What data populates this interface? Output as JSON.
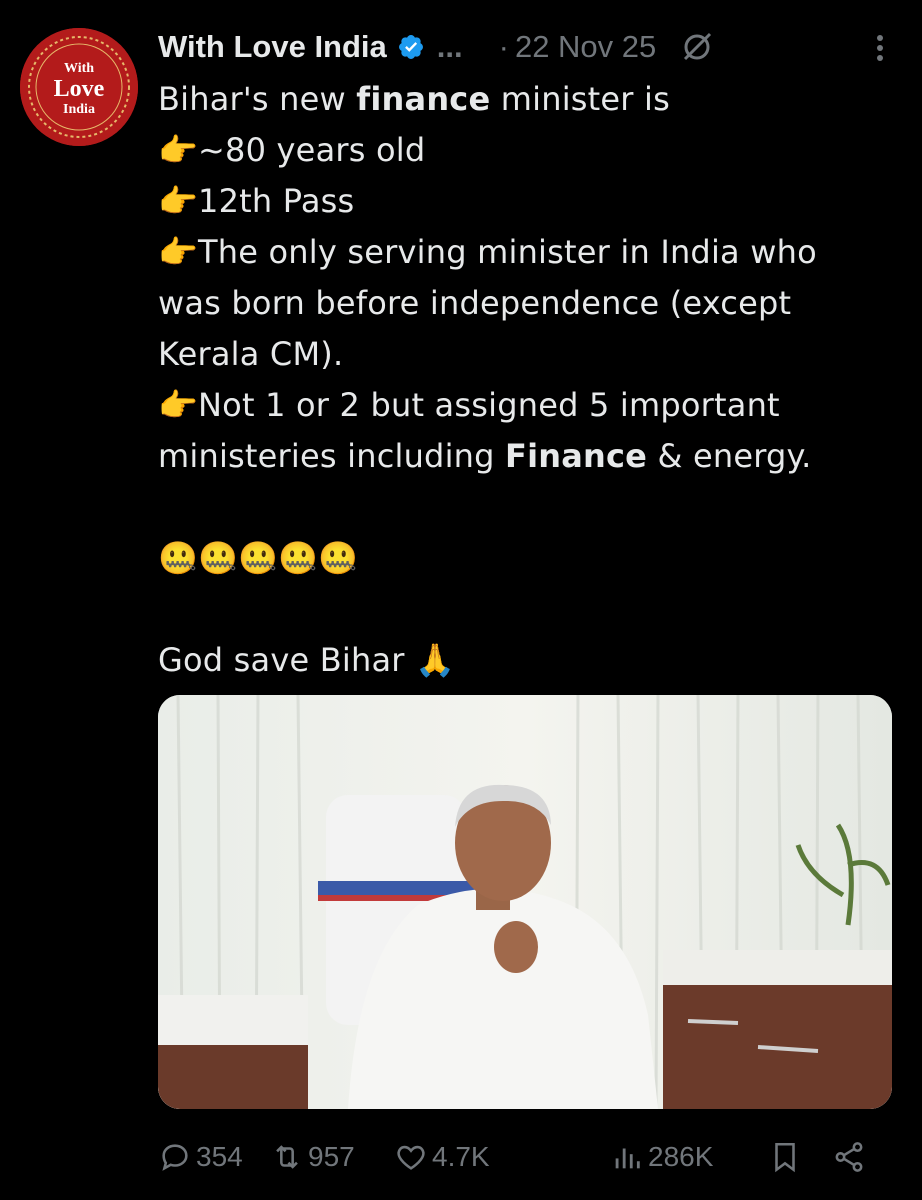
{
  "tweet": {
    "author_name": "With Love India",
    "truncation": "...",
    "separator": "·",
    "date": "22 Nov 25",
    "avatar_text": [
      "With",
      "Love",
      "India"
    ],
    "line1_pre": "Bihar's new ",
    "line1_bold": "finance",
    "line1_post": " minister is",
    "bullet_icon": "👉",
    "bullet1": "~80 years old",
    "bullet2": "12th Pass",
    "bullet3": "The only serving minister in India who was born before independence (except Kerala CM).",
    "bullet4_pre": "Not 1 or 2 but assigned 5 important ministeries including ",
    "bullet4_bold": "Finance",
    "bullet4_post": " & energy.",
    "emoji_row": "🤐🤐🤐🤐🤐",
    "closing": "God save Bihar 🙏"
  },
  "actions": {
    "replies": "354",
    "reposts": "957",
    "likes": "4.7K",
    "views": "286K"
  },
  "icons": {
    "verified": "verified-badge-icon",
    "grok": "grok-icon",
    "more": "more-vertical-icon",
    "reply": "reply-icon",
    "repost": "repost-icon",
    "like": "heart-icon",
    "views": "views-icon",
    "bookmark": "bookmark-icon",
    "share": "share-icon"
  },
  "colors": {
    "background": "#000000",
    "text": "#e7e9ea",
    "muted": "#71767b",
    "verified": "#1d9bf0",
    "avatar": "#b31b1b"
  }
}
